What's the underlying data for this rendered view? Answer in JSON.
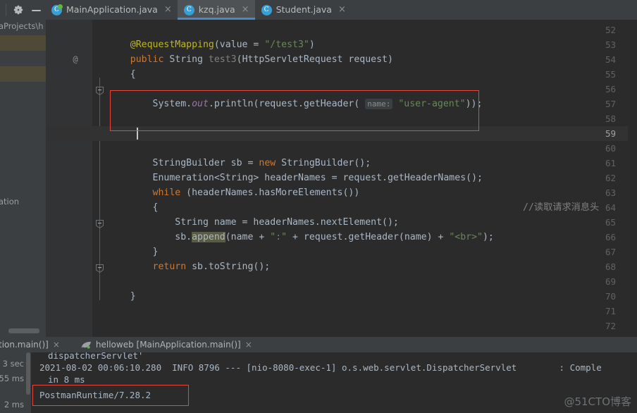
{
  "window": {
    "toolbar_icons": [
      {
        "name": "gear-icon",
        "label": "Settings"
      },
      {
        "name": "minimize-icon",
        "label": "Minimize"
      }
    ]
  },
  "editor_tabs": [
    {
      "label": "MainApplication.java",
      "icon": "java-class-run-icon",
      "active": false,
      "close": "×"
    },
    {
      "label": "kzq.java",
      "icon": "java-class-icon",
      "active": true,
      "close": "×"
    },
    {
      "label": "Student.java",
      "icon": "java-class-icon",
      "active": false,
      "close": "×"
    }
  ],
  "project_panel": {
    "path_label": "aProjects\\h",
    "item_label": "ation"
  },
  "code": {
    "first_line_number": 52,
    "line_count": 21,
    "current_line": 59,
    "annotation_gutter_line": 54,
    "annotation_gutter_symbol": "@",
    "lines": [
      {
        "n": 52,
        "text": ""
      },
      {
        "n": 53,
        "text": "    @RequestMapping(value = \"/test3\")"
      },
      {
        "n": 54,
        "text": "    public String test3(HttpServletRequest request)"
      },
      {
        "n": 55,
        "text": "    {"
      },
      {
        "n": 56,
        "text": ""
      },
      {
        "n": 57,
        "text": "        System.out.println(request.getHeader( name: \"user-agent\"));"
      },
      {
        "n": 58,
        "text": ""
      },
      {
        "n": 59,
        "text": ""
      },
      {
        "n": 60,
        "text": ""
      },
      {
        "n": 61,
        "text": "        StringBuilder sb = new StringBuilder();"
      },
      {
        "n": 62,
        "text": "        Enumeration<String> headerNames = request.getHeaderNames();"
      },
      {
        "n": 63,
        "text": "        while (headerNames.hasMoreElements())"
      },
      {
        "n": 64,
        "text": "        {"
      },
      {
        "n": 65,
        "text": "            String name = headerNames.nextElement();"
      },
      {
        "n": 66,
        "text": "            sb.append(name + \":\" + request.getHeader(name) + \"<br>\");"
      },
      {
        "n": 67,
        "text": "        }"
      },
      {
        "n": 68,
        "text": "        return sb.toString();"
      },
      {
        "n": 69,
        "text": ""
      },
      {
        "n": 70,
        "text": "    }"
      },
      {
        "n": 71,
        "text": ""
      },
      {
        "n": 72,
        "text": ""
      }
    ],
    "inline_hint": "name:",
    "side_comment": "//读取请求消息头",
    "occurrence_highlight": "append"
  },
  "run_tool_window": {
    "tabs": [
      {
        "label": "tion.main()]",
        "icon": "none",
        "close": "×",
        "truncated": true
      },
      {
        "label": "helloweb [MainApplication.main()]",
        "icon": "spring-boot-leaf-icon",
        "close": "×",
        "truncated": false
      }
    ]
  },
  "console": {
    "left_labels": [
      "3 sec",
      "55 ms",
      "2 ms"
    ],
    "lines": [
      "dispatcherServlet'",
      "2021-08-02 00:06:10.280  INFO 8796 --- [nio-8080-exec-1] o.s.web.servlet.DispatcherServlet        : Comple",
      "in 8 ms",
      "PostmanRuntime/7.28.2"
    ],
    "highlighted_line": "PostmanRuntime/7.28.2"
  },
  "watermark": "@51CTO博客",
  "colors": {
    "annotation_red": "#e8453c",
    "accent_blue": "#4a88c7",
    "editor_bg": "#2b2b2b",
    "chrome_bg": "#3c3f41",
    "gutter_bg": "#313335",
    "keyword": "#cc7832",
    "string": "#6a8759",
    "annotation": "#bbb529",
    "comment": "#808080",
    "field": "#9876aa",
    "plain": "#a9b7c6"
  }
}
